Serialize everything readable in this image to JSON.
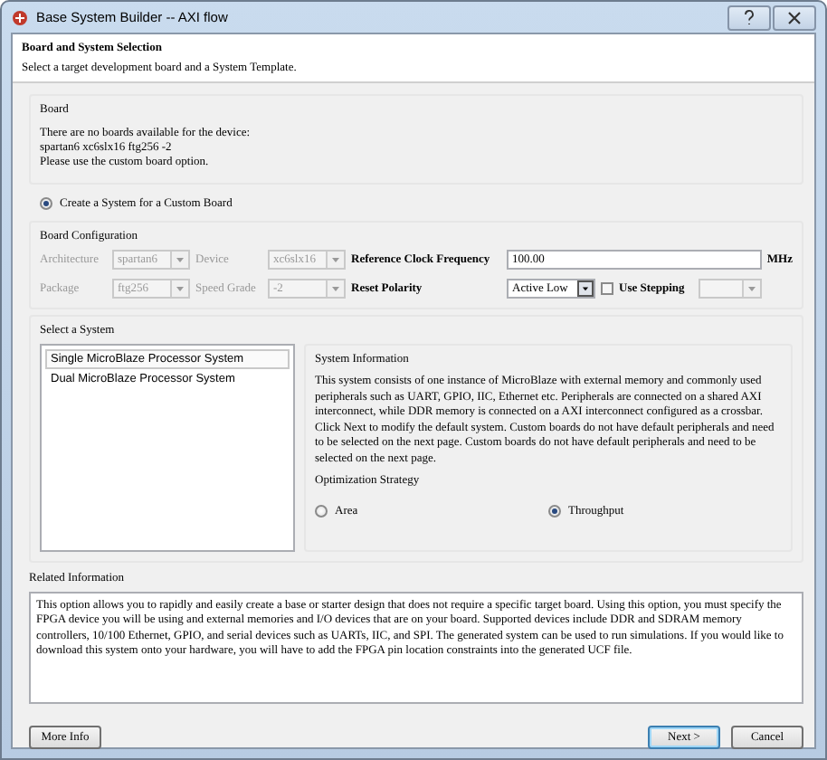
{
  "window": {
    "title": "Base System Builder -- AXI flow"
  },
  "header": {
    "title": "Board and System Selection",
    "subtitle": "Select a target development board and a System Template."
  },
  "board": {
    "label": "Board",
    "message": [
      "There are no boards available for the device:",
      "spartan6 xc6slx16 ftg256 -2",
      "Please use the custom board option."
    ],
    "custom_board_option": {
      "label": "Create a System for a Custom Board",
      "selected": true
    }
  },
  "board_configuration": {
    "label": "Board Configuration",
    "rows": [
      [
        {
          "kind": "combo",
          "label": "Architecture",
          "value": "spartan6",
          "disabled": true
        },
        {
          "kind": "combo",
          "label": "Device",
          "value": "xc6slx16",
          "disabled": true
        },
        {
          "kind": "text",
          "label": "Reference Clock Frequency",
          "value": "100.00",
          "unit": "MHz"
        }
      ],
      [
        {
          "kind": "combo",
          "label": "Package",
          "value": "ftg256",
          "disabled": true
        },
        {
          "kind": "combo",
          "label": "Speed Grade",
          "value": "-2",
          "disabled": true
        },
        {
          "kind": "combo",
          "label": "Reset Polarity",
          "value": "Active Low",
          "disabled": false
        },
        {
          "kind": "checkbox",
          "label": "Use Stepping",
          "checked": false
        },
        {
          "kind": "combo",
          "disabled": true
        }
      ]
    ]
  },
  "select_system": {
    "label": "Select a System",
    "items": [
      {
        "label": "Single MicroBlaze Processor System",
        "selected": true
      },
      {
        "label": "Dual MicroBlaze Processor System",
        "selected": false
      }
    ],
    "system_information": {
      "label": "System Information",
      "text": "This system consists of one instance of MicroBlaze with external memory and commonly used peripherals such as UART, GPIO, IIC, Ethernet etc. Peripherals are connected on a shared AXI interconnect, while DDR memory is connected on a AXI interconnect configured as a crossbar. Click Next to modify the default system. Custom boards do not have default peripherals and need to be selected on the next page. Custom boards do not have default peripherals and need to be selected on the next page."
    },
    "optimization_strategy": {
      "label": "Optimization Strategy",
      "options": [
        {
          "label": "Area",
          "selected": false
        },
        {
          "label": "Throughput",
          "selected": true
        }
      ]
    }
  },
  "related_information": {
    "label": "Related Information",
    "text": "This option allows you to rapidly and easily create a base or starter design that does not require a specific target board. Using this option, you must specify the FPGA device you will be using and external memories and I/O devices that are on your board. Supported devices include DDR and SDRAM memory controllers, 10/100 Ethernet, GPIO, and serial devices such as UARTs, IIC, and SPI. The generated system can be used to run simulations. If you would like to download this system onto your hardware, you will have to add the FPGA pin location constraints into the generated UCF file."
  },
  "buttons": [
    {
      "label": "More Info",
      "default": false
    },
    {
      "label": "Next >",
      "default": true
    },
    {
      "label": "Cancel",
      "default": false
    }
  ]
}
